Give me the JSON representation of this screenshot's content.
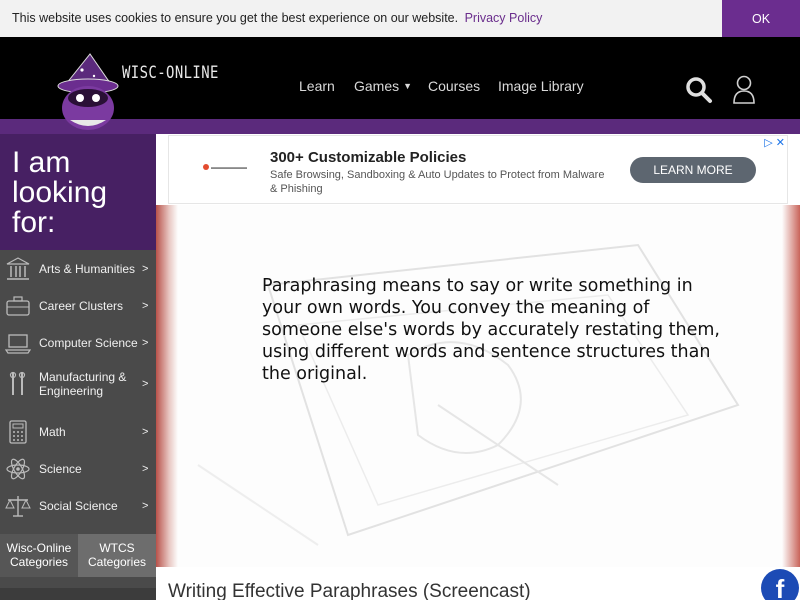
{
  "cookie_bar": {
    "text": "This website uses cookies to ensure you get the best experience on our website.",
    "link": "Privacy Policy",
    "ok": "OK"
  },
  "header": {
    "logo_text": "WISC-ONLINE",
    "nav": [
      {
        "label": "Learn"
      },
      {
        "label": "Games",
        "has_dropdown": true
      },
      {
        "label": "Courses"
      },
      {
        "label": "Image Library"
      }
    ]
  },
  "sidebar": {
    "heading": "I am looking for:",
    "items": [
      {
        "label": "Arts & Humanities",
        "icon": "columns-icon"
      },
      {
        "label": "Career Clusters",
        "icon": "briefcase-icon"
      },
      {
        "label": "Computer Science",
        "icon": "laptop-icon"
      },
      {
        "label": "Manufacturing & Engineering",
        "icon": "tools-icon"
      },
      {
        "label": "Math",
        "icon": "calculator-icon"
      },
      {
        "label": "Science",
        "icon": "atom-icon"
      },
      {
        "label": "Social Science",
        "icon": "scales-icon"
      }
    ],
    "arrow": ">",
    "tabs": [
      {
        "label": "Wisc-Online Categories"
      },
      {
        "label": "WTCS Categories"
      }
    ]
  },
  "ad": {
    "title": "300+ Customizable Policies",
    "description": "Safe Browsing, Sandboxing & Auto Updates to Protect from Malware & Phishing",
    "button": "LEARN MORE"
  },
  "video": {
    "text": "Paraphrasing means to say or write something in your own words. You convey the meaning of someone else's words by accurately restating them, using different words and sentence structures than the original."
  },
  "page": {
    "title": "Writing Effective Paraphrases (Screencast)"
  },
  "colors": {
    "brand_purple": "#6b2d8f",
    "sidebar_purple": "#472063",
    "sidebar_gray": "#4a4a4a",
    "facebook_blue": "#1c4bb5"
  }
}
